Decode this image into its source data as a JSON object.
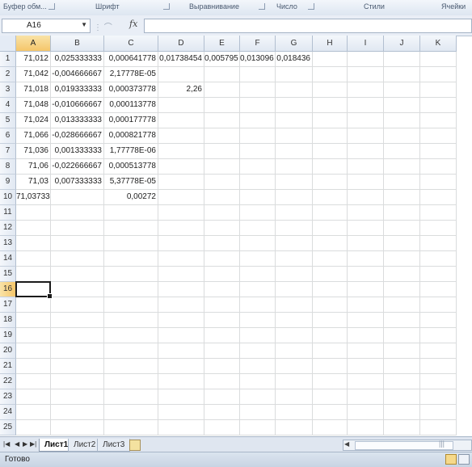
{
  "ribbon": {
    "groups": [
      {
        "label": "Буфер обм..."
      },
      {
        "label": "Шрифт"
      },
      {
        "label": "Выравнивание"
      },
      {
        "label": "Число"
      },
      {
        "label": "Стили"
      },
      {
        "label": "Ячейки"
      }
    ]
  },
  "formula_bar": {
    "name_box": "A16",
    "fx_label": "fx",
    "formula": ""
  },
  "columns": [
    "A",
    "B",
    "C",
    "D",
    "E",
    "F",
    "G",
    "H",
    "I",
    "J",
    "K"
  ],
  "rows": [
    "1",
    "2",
    "3",
    "4",
    "5",
    "6",
    "7",
    "8",
    "9",
    "10",
    "11",
    "12",
    "13",
    "14",
    "15",
    "16",
    "17",
    "18",
    "19",
    "20",
    "21",
    "22",
    "23",
    "24",
    "25"
  ],
  "cells": [
    [
      "71,012",
      "0,025333333",
      "0,000641778",
      "0,01738454",
      "0,005795",
      "0,013096",
      "0,018436",
      "",
      "",
      "",
      ""
    ],
    [
      "71,042",
      "-0,004666667",
      "2,17778E-05",
      "",
      "",
      "",
      "",
      "",
      "",
      "",
      ""
    ],
    [
      "71,018",
      "0,019333333",
      "0,000373778",
      "2,26",
      "",
      "",
      "",
      "",
      "",
      "",
      ""
    ],
    [
      "71,048",
      "-0,010666667",
      "0,000113778",
      "",
      "",
      "",
      "",
      "",
      "",
      "",
      ""
    ],
    [
      "71,024",
      "0,013333333",
      "0,000177778",
      "",
      "",
      "",
      "",
      "",
      "",
      "",
      ""
    ],
    [
      "71,066",
      "-0,028666667",
      "0,000821778",
      "",
      "",
      "",
      "",
      "",
      "",
      "",
      ""
    ],
    [
      "71,036",
      "0,001333333",
      "1,77778E-06",
      "",
      "",
      "",
      "",
      "",
      "",
      "",
      ""
    ],
    [
      "71,06",
      "-0,022666667",
      "0,000513778",
      "",
      "",
      "",
      "",
      "",
      "",
      "",
      ""
    ],
    [
      "71,03",
      "0,007333333",
      "5,37778E-05",
      "",
      "",
      "",
      "",
      "",
      "",
      "",
      ""
    ],
    [
      "71,03733",
      "",
      "0,00272",
      "",
      "",
      "",
      "",
      "",
      "",
      "",
      ""
    ]
  ],
  "active_cell": {
    "column": "A",
    "row": "16"
  },
  "sheet_tabs": [
    {
      "label": "Лист1",
      "active": true
    },
    {
      "label": "Лист2",
      "active": false
    },
    {
      "label": "Лист3",
      "active": false
    }
  ],
  "status_bar": {
    "ready": "Готово"
  },
  "colors": {
    "selected_header": "#f5c66a",
    "grid_line": "#dadcdd",
    "accent": "#2a5699"
  }
}
